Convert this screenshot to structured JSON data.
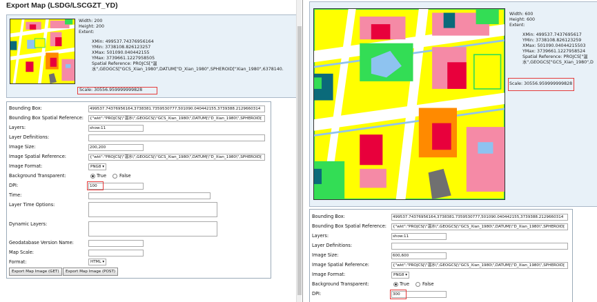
{
  "left": {
    "title": "Export Map (LSDG/LSCGZT_YD)",
    "info": {
      "width_line": "Width: 200",
      "height_line": "Height: 200",
      "extent_label": "Extent:",
      "xmin": "XMin: 499537.74376956164",
      "ymin": "YMin: 3738108.826123257",
      "xmax": "XMax: 501090.040442155",
      "ymax": "YMax: 3739661.1227958505",
      "spatial_ref": "Spatial Reference: PROJCS[\"温",
      "spatial_ref_cont": "水\",GEOGCS[\"GCS_Xian_1980\",DATUM[\"D_Xian_1980\",SPHEROID[\"Xian_1980\",6378140.",
      "scale": "Scale: 30556.959999999828"
    },
    "form": {
      "bbox_label": "Bounding Box:",
      "bbox_value": "499537.74376956164,3738381.7359530777,501090.040442155,3739388.2129660314",
      "bbox_sr_label": "Bounding Box Spatial Reference:",
      "bbox_sr_value": "{\"wkt\":\"PROJCS[\\\"温水\\\",GEOGCS[\\\"GCS_Xian_1980\\\",DATUM[\\\"D_Xian_1980\\\",SPHEROID[",
      "layers_label": "Layers:",
      "layers_value": "show:11",
      "layer_defs_label": "Layer Definitions:",
      "image_size_label": "Image Size:",
      "image_size_value": "200,200",
      "image_sr_label": "Image Spatial Reference:",
      "image_sr_value": "{\"wkt\":\"PROJCS[\\\"温水\\\",GEOGCS[\\\"GCS_Xian_1980\\\",DATUM[\\\"D_Xian_1980\\\",SPHEROID[",
      "image_format_label": "Image Format:",
      "image_format_value": "PNG8",
      "bg_transparent_label": "Background Transparent:",
      "true_label": "True",
      "false_label": "False",
      "dpi_label": "DPI:",
      "dpi_value": "100",
      "time_label": "Time:",
      "layer_time_label": "Layer Time Options:",
      "dynamic_layers_label": "Dynamic Layers:",
      "gdb_version_label": "Geodatabase Version Name:",
      "map_scale_label": "Map Scale:",
      "format_label": "Format:",
      "format_value": "HTML",
      "export_get": "Export Map Image (GET)",
      "export_post": "Export Map Image (POST)"
    }
  },
  "right": {
    "info": {
      "width_line": "Width: 600",
      "height_line": "Height: 600",
      "extent_label": "Extent:",
      "xmin": "XMin: 499537.7437695617",
      "ymin": "YMin: 3738108.826123259",
      "xmax": "XMax: 501090.04044215503",
      "ymax": "YMax: 3739661.1227958524",
      "spatial_ref": "Spatial Reference: PROJCS[\"温",
      "spatial_ref_cont": "水\",GEOGCS[\"GCS_Xian_1980\",D",
      "scale": "Scale: 30556.959999999828"
    },
    "form": {
      "bbox_label": "Bounding Box:",
      "bbox_value": "499537.74376956164,3738381.7359530777,501090.040442155,3739388.2129660314",
      "bbox_sr_label": "Bounding Box Spatial Reference:",
      "bbox_sr_value": "{\"wkt\":\"PROJCS[\\\"温水\\\",GEOGCS[\\\"GCS_Xian_1980\\\",DATUM[\\\"D_Xian_1980\\\",SPHEROID[",
      "layers_label": "Layers:",
      "layers_value": "show:11",
      "layer_defs_label": "Layer Definitions:",
      "image_size_label": "Image Size:",
      "image_size_value": "600,600",
      "image_sr_label": "Image Spatial Reference:",
      "image_sr_value": "{\"wkt\":\"PROJCS[\\\"温水\\\",GEOGCS[\\\"GCS_Xian_1980\\\",DATUM[\\\"D_Xian_1980\\\",SPHEROID[",
      "image_format_label": "Image Format:",
      "image_format_value": "PNG8",
      "bg_transparent_label": "Background Transparent:",
      "true_label": "True",
      "false_label": "False",
      "dpi_label": "DPI:",
      "dpi_value": "300"
    }
  },
  "colors": {
    "highlight": "#e43a3a",
    "info_bg": "#e8f1f8",
    "map_yellow": "#ffff00",
    "map_green": "#33dd55",
    "map_pink": "#f58aa6",
    "map_red": "#e8003c",
    "map_orange": "#ff8a00",
    "map_blue": "#8ec3f0",
    "map_gray": "#707070",
    "map_teal": "#0a6a7a"
  }
}
